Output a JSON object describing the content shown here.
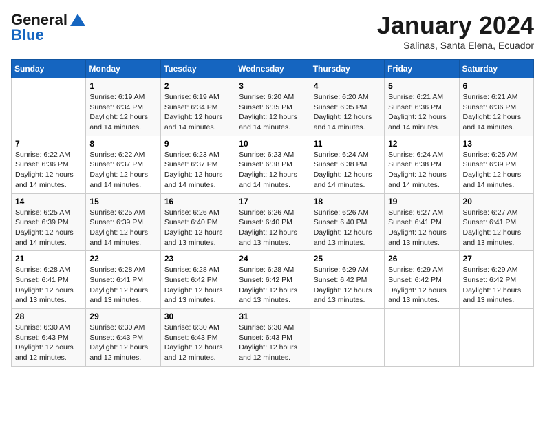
{
  "header": {
    "logo_general": "General",
    "logo_blue": "Blue",
    "month": "January 2024",
    "location": "Salinas, Santa Elena, Ecuador"
  },
  "days_of_week": [
    "Sunday",
    "Monday",
    "Tuesday",
    "Wednesday",
    "Thursday",
    "Friday",
    "Saturday"
  ],
  "weeks": [
    [
      {
        "day": "",
        "info": ""
      },
      {
        "day": "1",
        "info": "Sunrise: 6:19 AM\nSunset: 6:34 PM\nDaylight: 12 hours\nand 14 minutes."
      },
      {
        "day": "2",
        "info": "Sunrise: 6:19 AM\nSunset: 6:34 PM\nDaylight: 12 hours\nand 14 minutes."
      },
      {
        "day": "3",
        "info": "Sunrise: 6:20 AM\nSunset: 6:35 PM\nDaylight: 12 hours\nand 14 minutes."
      },
      {
        "day": "4",
        "info": "Sunrise: 6:20 AM\nSunset: 6:35 PM\nDaylight: 12 hours\nand 14 minutes."
      },
      {
        "day": "5",
        "info": "Sunrise: 6:21 AM\nSunset: 6:36 PM\nDaylight: 12 hours\nand 14 minutes."
      },
      {
        "day": "6",
        "info": "Sunrise: 6:21 AM\nSunset: 6:36 PM\nDaylight: 12 hours\nand 14 minutes."
      }
    ],
    [
      {
        "day": "7",
        "info": "Sunrise: 6:22 AM\nSunset: 6:36 PM\nDaylight: 12 hours\nand 14 minutes."
      },
      {
        "day": "8",
        "info": "Sunrise: 6:22 AM\nSunset: 6:37 PM\nDaylight: 12 hours\nand 14 minutes."
      },
      {
        "day": "9",
        "info": "Sunrise: 6:23 AM\nSunset: 6:37 PM\nDaylight: 12 hours\nand 14 minutes."
      },
      {
        "day": "10",
        "info": "Sunrise: 6:23 AM\nSunset: 6:38 PM\nDaylight: 12 hours\nand 14 minutes."
      },
      {
        "day": "11",
        "info": "Sunrise: 6:24 AM\nSunset: 6:38 PM\nDaylight: 12 hours\nand 14 minutes."
      },
      {
        "day": "12",
        "info": "Sunrise: 6:24 AM\nSunset: 6:38 PM\nDaylight: 12 hours\nand 14 minutes."
      },
      {
        "day": "13",
        "info": "Sunrise: 6:25 AM\nSunset: 6:39 PM\nDaylight: 12 hours\nand 14 minutes."
      }
    ],
    [
      {
        "day": "14",
        "info": "Sunrise: 6:25 AM\nSunset: 6:39 PM\nDaylight: 12 hours\nand 14 minutes."
      },
      {
        "day": "15",
        "info": "Sunrise: 6:25 AM\nSunset: 6:39 PM\nDaylight: 12 hours\nand 14 minutes."
      },
      {
        "day": "16",
        "info": "Sunrise: 6:26 AM\nSunset: 6:40 PM\nDaylight: 12 hours\nand 13 minutes."
      },
      {
        "day": "17",
        "info": "Sunrise: 6:26 AM\nSunset: 6:40 PM\nDaylight: 12 hours\nand 13 minutes."
      },
      {
        "day": "18",
        "info": "Sunrise: 6:26 AM\nSunset: 6:40 PM\nDaylight: 12 hours\nand 13 minutes."
      },
      {
        "day": "19",
        "info": "Sunrise: 6:27 AM\nSunset: 6:41 PM\nDaylight: 12 hours\nand 13 minutes."
      },
      {
        "day": "20",
        "info": "Sunrise: 6:27 AM\nSunset: 6:41 PM\nDaylight: 12 hours\nand 13 minutes."
      }
    ],
    [
      {
        "day": "21",
        "info": "Sunrise: 6:28 AM\nSunset: 6:41 PM\nDaylight: 12 hours\nand 13 minutes."
      },
      {
        "day": "22",
        "info": "Sunrise: 6:28 AM\nSunset: 6:41 PM\nDaylight: 12 hours\nand 13 minutes."
      },
      {
        "day": "23",
        "info": "Sunrise: 6:28 AM\nSunset: 6:42 PM\nDaylight: 12 hours\nand 13 minutes."
      },
      {
        "day": "24",
        "info": "Sunrise: 6:28 AM\nSunset: 6:42 PM\nDaylight: 12 hours\nand 13 minutes."
      },
      {
        "day": "25",
        "info": "Sunrise: 6:29 AM\nSunset: 6:42 PM\nDaylight: 12 hours\nand 13 minutes."
      },
      {
        "day": "26",
        "info": "Sunrise: 6:29 AM\nSunset: 6:42 PM\nDaylight: 12 hours\nand 13 minutes."
      },
      {
        "day": "27",
        "info": "Sunrise: 6:29 AM\nSunset: 6:42 PM\nDaylight: 12 hours\nand 13 minutes."
      }
    ],
    [
      {
        "day": "28",
        "info": "Sunrise: 6:30 AM\nSunset: 6:43 PM\nDaylight: 12 hours\nand 12 minutes."
      },
      {
        "day": "29",
        "info": "Sunrise: 6:30 AM\nSunset: 6:43 PM\nDaylight: 12 hours\nand 12 minutes."
      },
      {
        "day": "30",
        "info": "Sunrise: 6:30 AM\nSunset: 6:43 PM\nDaylight: 12 hours\nand 12 minutes."
      },
      {
        "day": "31",
        "info": "Sunrise: 6:30 AM\nSunset: 6:43 PM\nDaylight: 12 hours\nand 12 minutes."
      },
      {
        "day": "",
        "info": ""
      },
      {
        "day": "",
        "info": ""
      },
      {
        "day": "",
        "info": ""
      }
    ]
  ]
}
